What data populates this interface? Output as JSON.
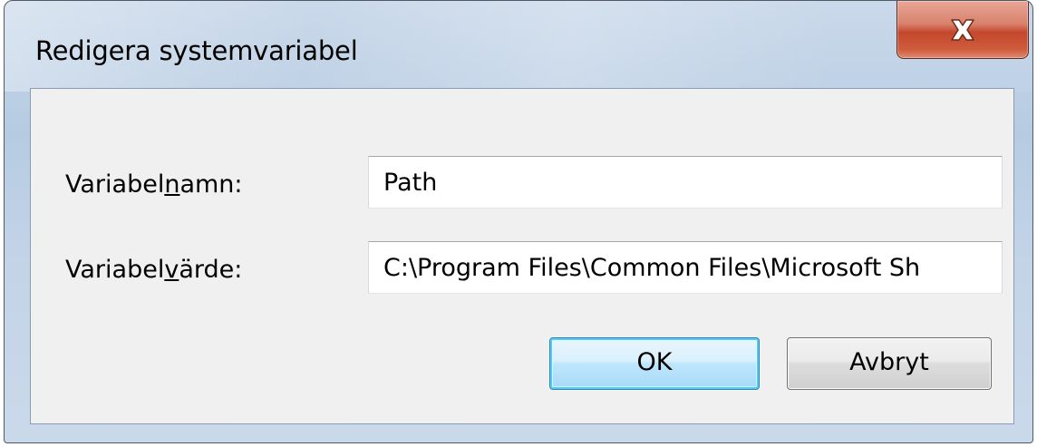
{
  "window": {
    "title": "Redigera systemvariabel"
  },
  "form": {
    "name_label_prefix": "Variabel",
    "name_label_accel": "n",
    "name_label_suffix": "amn:",
    "name_value": "Path",
    "value_label_prefix": "Variabel",
    "value_label_accel": "v",
    "value_label_suffix": "ärde:",
    "value_value": "C:\\Program Files\\Common Files\\Microsoft Sh"
  },
  "buttons": {
    "ok_label": "OK",
    "cancel_label": "Avbryt"
  },
  "icons": {
    "close": "close-icon"
  },
  "colors": {
    "close_button": "#c4472c",
    "ok_focus": "#48d1f6",
    "dialog_background": "#f0f0f0"
  }
}
